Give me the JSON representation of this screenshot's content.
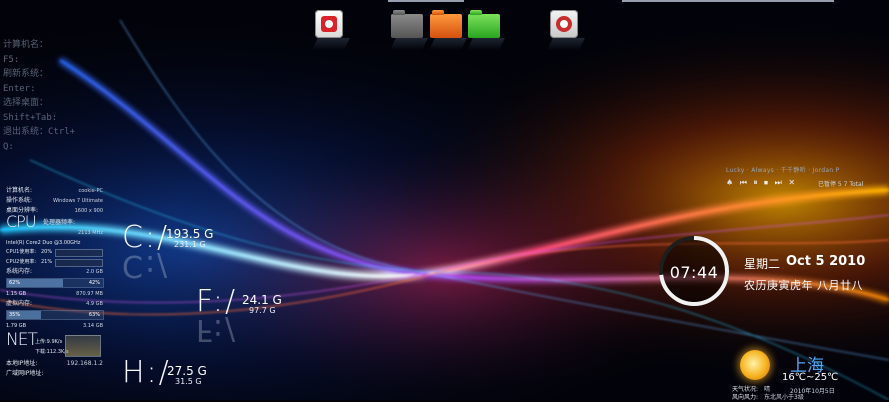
{
  "console": {
    "lines": [
      "计算机名：",
      "F5:",
      "刷新系统：",
      "Enter:",
      "选择桌面：",
      "Shift+Tab:",
      "退出系统：Ctrl+",
      "Q:"
    ]
  },
  "sysinfo": {
    "computer_name_label": "计算机名:",
    "computer_name": "cookie-PC",
    "os_label": "操作系统:",
    "os": "Windows 7 Ultimate",
    "resolution_label": "桌面分辨率:",
    "resolution": "1600 x 900",
    "cpu_title": "CPU",
    "cpu_freq_label": "处理器频率:",
    "cpu_freq": "2113 MHz",
    "cpu_model": "Intel(R) Core2 Duo @3.00GHz",
    "cpu1_label": "CPU1使用率:",
    "cpu1_value": "20%",
    "cpu2_label": "CPU2使用率:",
    "cpu2_value": "21%",
    "mem_label": "系统内存:",
    "mem_total": "2.0 GB",
    "mem_pct": "62%",
    "mem_pct_right": "42%",
    "mem_used": "1.15 GB",
    "mem_free": "870.97 MB",
    "mem_fill": 0.58,
    "vmem_label": "虚拟内存:",
    "vmem_total": "4.9 GB",
    "vmem_pct": "35%",
    "vmem_pct_right": "63%",
    "vmem_used": "1.79 GB",
    "vmem_free": "3.14 GB",
    "vmem_fill": 0.35,
    "net_title": "NET",
    "upload": "上传:9.9K/s",
    "download": "下载:112.3K/s",
    "ip_label": "本地IP地址:",
    "ip": "192.168.1.2",
    "wan_label": "广域网IP地址:"
  },
  "drives": [
    {
      "letter": "C:/",
      "total": "193.5 G",
      "free": "231.1 G"
    },
    {
      "letter": "F:/",
      "total": "24.1 G",
      "free": "97.7 G"
    },
    {
      "letter": "H:/",
      "total": "27.5 G",
      "free": "31.5 G"
    }
  ],
  "music": {
    "track": "Lucky · Always · 千千静听 · Jordan P",
    "status": "已暂停 5 7 Total"
  },
  "clock": {
    "time": "07:44",
    "weekday": "星期二",
    "date": "Oct 5 2010",
    "lunar": "农历庚寅虎年  八月廿八",
    "progress": 0.73
  },
  "weather": {
    "city": "上海",
    "temp": "16℃~25℃",
    "date": "2010年10月5日",
    "condition_label": "天气状况:",
    "condition": "晴",
    "wind_label": "风向风力:",
    "wind": "东北风小于3级"
  },
  "colors": {
    "accent": "#4fa8ff",
    "folder_gray": "#6b6b6b",
    "folder_orange": "#e8691c",
    "folder_green": "#3cbb2c",
    "app_red": "#d8232a"
  },
  "icons": [
    "app-q-icon",
    "folder-gray-icon",
    "folder-orange-icon",
    "folder-green-icon",
    "app-recycle-icon",
    "sun-icon"
  ]
}
